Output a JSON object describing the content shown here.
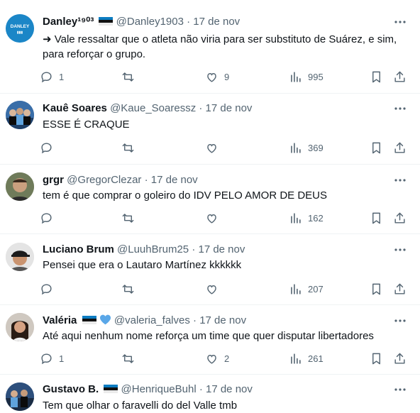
{
  "tweets": [
    {
      "name": "Danley¹⁹⁰³",
      "handle": "@Danley1903",
      "date": "· 17 de nov",
      "text": "➜ Vale ressaltar que o atleta não viria para ser substituto de Suárez, e sim, para reforçar o grupo.",
      "replies": "1",
      "retweets": "",
      "likes": "9",
      "views": "995",
      "avatar_icon": "danley-logo-avatar",
      "avatar_color": "#1b86c7"
    },
    {
      "name": "Kauê Soares",
      "handle": "@Kaue_Soaressz",
      "date": "· 17 de nov",
      "text": "ESSE É CRAQUE",
      "replies": "",
      "retweets": "",
      "likes": "",
      "views": "369",
      "avatar_icon": "team-photo-avatar",
      "avatar_color": "#3a6ea8"
    },
    {
      "name": "grgr",
      "handle": "@GregorClezar",
      "date": "· 17 de nov",
      "text": "tem é que comprar o goleiro do IDV PELO AMOR DE DEUS",
      "replies": "",
      "retweets": "",
      "likes": "",
      "views": "162",
      "avatar_icon": "person-avatar",
      "avatar_color": "#6f7b5a"
    },
    {
      "name": "Luciano Brum",
      "handle": "@LuuhBrum25",
      "date": "· 17 de nov",
      "text": "Pensei que era o Lautaro Martínez kkkkkk",
      "replies": "",
      "retweets": "",
      "likes": "",
      "views": "207",
      "avatar_icon": "cap-person-avatar",
      "avatar_color": "#d9d9d9"
    },
    {
      "name": "Valéria",
      "handle": "@valeria_falves",
      "date": "· 17 de nov",
      "text": "Até aqui nenhum nome  reforça um time que quer disputar libertadores",
      "replies": "1",
      "retweets": "",
      "likes": "2",
      "views": "261",
      "avatar_icon": "woman-avatar",
      "avatar_color": "#c9c3bd"
    },
    {
      "name": "Gustavo B.",
      "handle": "@HenriqueBuhl",
      "date": "· 17 de nov",
      "text": "Tem que olhar o faravelli do del Valle tmb",
      "replies": "",
      "retweets": "",
      "likes": "",
      "views": "",
      "avatar_icon": "team-photo-avatar",
      "avatar_color": "#2d4f7c"
    }
  ],
  "colors": {
    "text": "#0f1419",
    "secondary": "#536471",
    "flag_blue": "#0c7cc1",
    "heart_blue": "#5aa7e8"
  }
}
